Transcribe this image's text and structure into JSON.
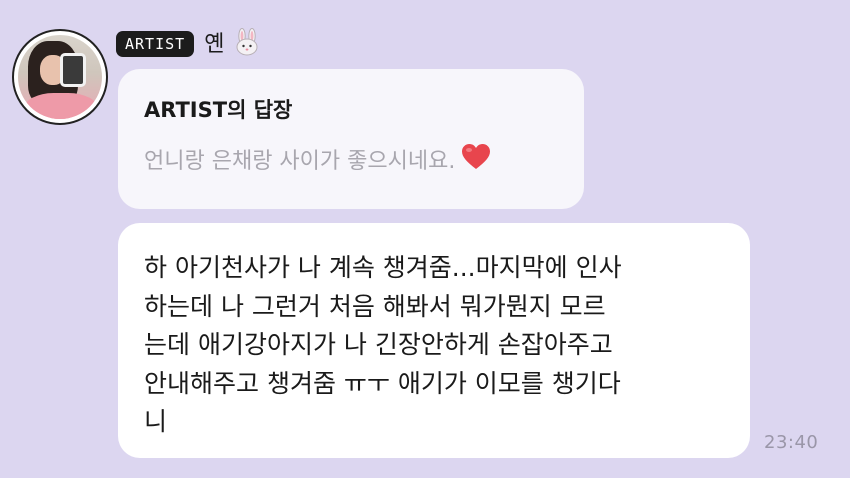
{
  "sender": {
    "badge": "ARTIST",
    "nickname": "옌",
    "nickname_emoji_icon": "rabbit-face-icon"
  },
  "reply": {
    "title": "ARTIST의 답장",
    "quote": "언니랑 은채랑 사이가 좋으시네요.",
    "quote_emoji_icon": "red-heart-icon"
  },
  "message": {
    "text": "하 아기천사가 나 계속 챙겨줌...마지막에 인사\n하는데 나 그런거 처음 해봐서 뭐가뭔지 모르\n는데 애기강아지가 나 긴장안하게 손잡아주고\n안내해주고 챙겨줌 ㅠㅜ 애기가 이모를 챙기다\n니",
    "time": "23:40"
  },
  "colors": {
    "background": "#dcd6f0",
    "bubble": "#ffffff",
    "reply_bubble": "#f7f6fb",
    "badge": "#1c1c1c",
    "heart": "#e8454d"
  }
}
